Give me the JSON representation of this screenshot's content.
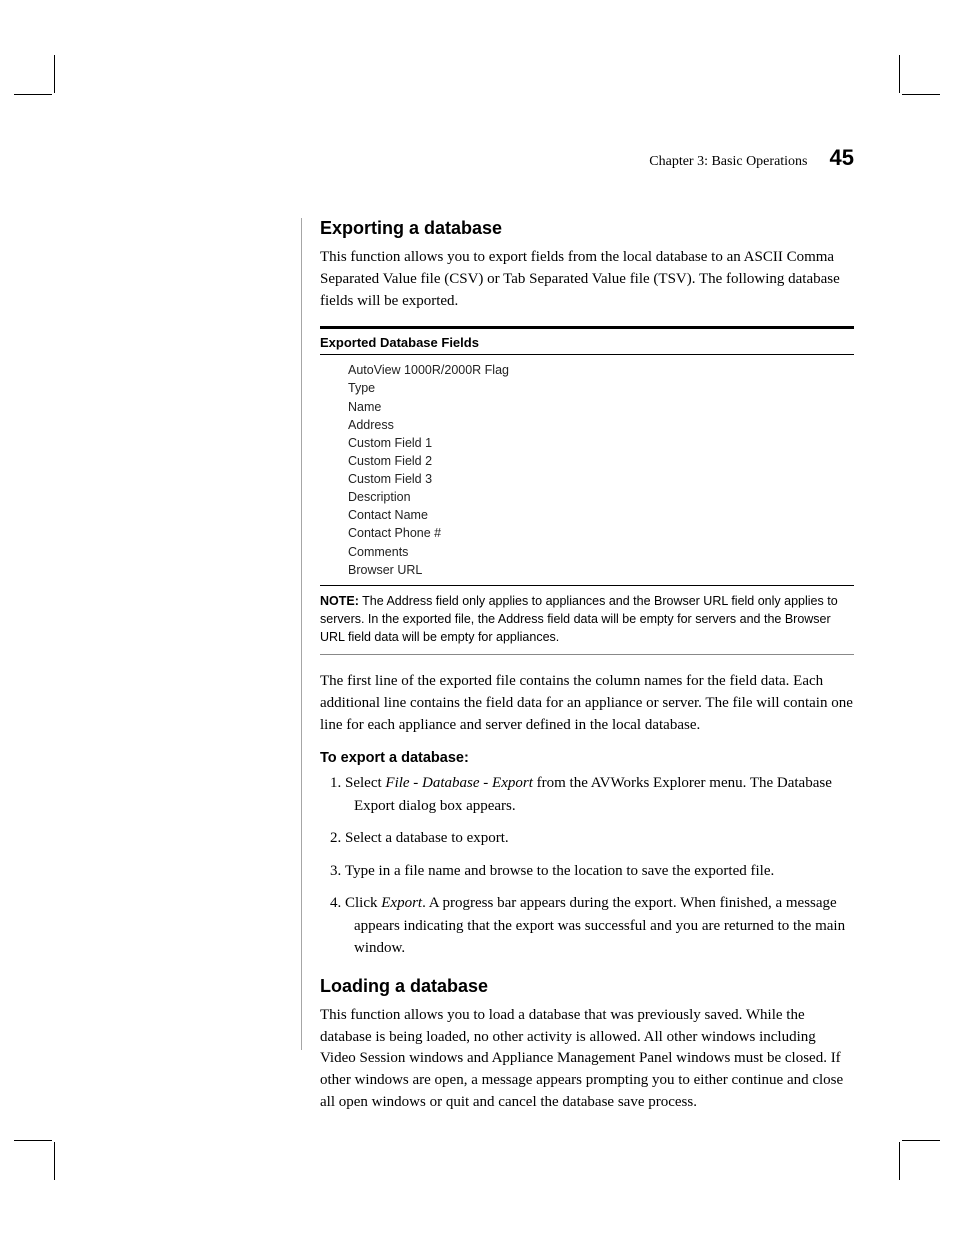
{
  "header": {
    "chapter": "Chapter 3: Basic Operations",
    "page_number": "45"
  },
  "section1": {
    "title": "Exporting a database",
    "intro": "This function allows you to export fields from the local database to an ASCII Comma Separated Value file (CSV) or Tab Separated Value file (TSV). The following database fields will be exported.",
    "table_title": "Exported Database Fields",
    "fields": [
      "AutoView 1000R/2000R Flag",
      "Type",
      "Name",
      "Address",
      "Custom Field 1",
      "Custom Field 2",
      "Custom Field 3",
      "Description",
      "Contact Name",
      "Contact Phone #",
      "Comments",
      "Browser URL"
    ],
    "note_label": "NOTE:",
    "note_text": " The Address field only applies to appliances and the Browser URL field only applies to servers. In the exported file, the Address field data will be empty for servers and the Browser URL field data will be empty for appliances.",
    "para2": "The first line of the exported file contains the column names for the field data. Each additional line contains the field data for an appliance or server. The file will contain one line for each appliance and server defined in the local database.",
    "proc_title": "To export a database:",
    "steps": {
      "s1_a": "Select ",
      "s1_b": "File - Database - Export",
      "s1_c": " from the AVWorks Explorer menu. The Database Export dialog box appears.",
      "s2": "Select a database to export.",
      "s3": "Type in a file name and browse to the location to save the exported file.",
      "s4_a": "Click ",
      "s4_b": "Export",
      "s4_c": ". A progress bar appears during the export. When finished, a message appears indicating that the export was successful and you are returned to the main window."
    }
  },
  "section2": {
    "title": "Loading a database",
    "intro": "This function allows you to load a database that was previously saved. While the database is being loaded, no other activity is allowed. All other windows including Video Session windows and Appliance Management Panel windows must be closed. If other windows are open, a message appears prompting you to either continue and close all open windows or quit and cancel the database save process."
  }
}
